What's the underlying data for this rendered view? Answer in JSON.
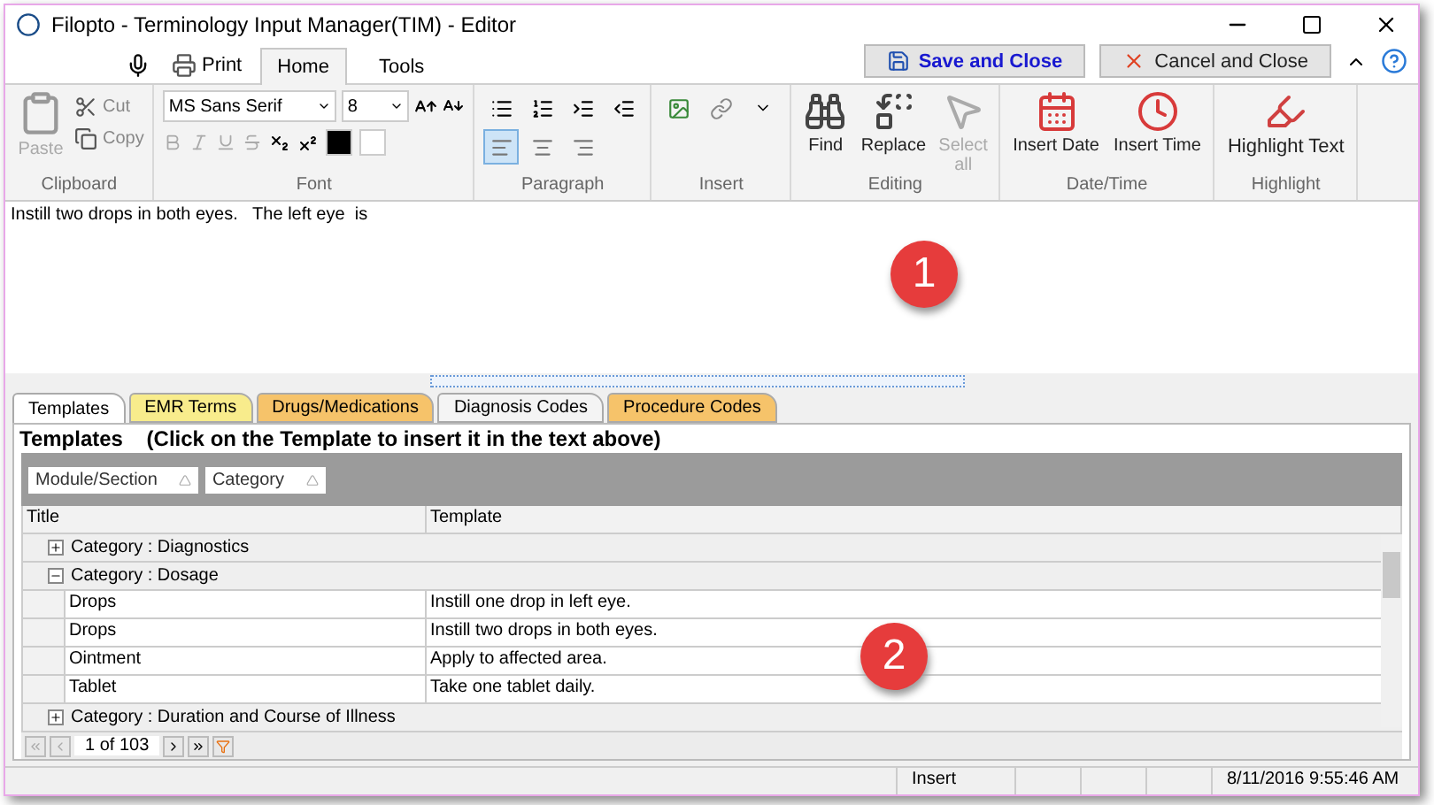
{
  "window": {
    "title": "Filopto - Terminology Input Manager(TIM) - Editor"
  },
  "quick_access": {
    "print": "Print"
  },
  "ribbon_tabs": [
    {
      "label": "Home",
      "selected": true
    },
    {
      "label": "Tools",
      "selected": false
    }
  ],
  "actions": [
    {
      "label": "Save and Close",
      "kind": "save"
    },
    {
      "label": "Cancel and Close",
      "kind": "cancel"
    }
  ],
  "clipboard": {
    "title": "Clipboard",
    "paste": "Paste",
    "cut": "Cut",
    "copy": "Copy"
  },
  "font": {
    "title": "Font",
    "family": "MS Sans Serif",
    "size": "8"
  },
  "paragraph": {
    "title": "Paragraph",
    "align_buttons": [
      {
        "kind": "left",
        "selected": true
      },
      {
        "kind": "center",
        "selected": false
      },
      {
        "kind": "right",
        "selected": false
      }
    ]
  },
  "insert": {
    "title": "Insert"
  },
  "editing": {
    "title": "Editing",
    "buttons": [
      {
        "label": "Find",
        "kind": "find",
        "disabled": false
      },
      {
        "label": "Replace",
        "kind": "replace",
        "disabled": false
      },
      {
        "label": "Select all",
        "kind": "select",
        "disabled": true
      }
    ]
  },
  "datetime": {
    "title": "Date/Time",
    "buttons": [
      {
        "label": "Insert Date",
        "kind": "date"
      },
      {
        "label": "Insert Time",
        "kind": "time"
      }
    ]
  },
  "highlight": {
    "title": "Highlight",
    "button": "Highlight Text"
  },
  "editor": {
    "value": "Instill two drops in both eyes.   The left eye  is",
    "callout": "1"
  },
  "lookup_tabs": [
    {
      "label": "Templates",
      "selected": true,
      "color": "#ffffff"
    },
    {
      "label": "EMR Terms",
      "selected": false,
      "color": "#f8ec8c"
    },
    {
      "label": "Drugs/Medications",
      "selected": false,
      "color": "#f6c36a"
    },
    {
      "label": "Diagnosis Codes",
      "selected": false,
      "color": "#f4f4f4"
    },
    {
      "label": "Procedure Codes",
      "selected": false,
      "color": "#f6c36a"
    }
  ],
  "templates": {
    "title": "Templates",
    "hint": "(Click on the Template to insert it in the text above)",
    "group_by": [
      "Module/Section",
      "Category"
    ],
    "columns": [
      "Title",
      "Template"
    ],
    "groups": [
      {
        "label": "Category : Diagnostics",
        "expanded": false
      },
      {
        "label": "Category : Dosage",
        "expanded": true,
        "rows": [
          [
            "Drops",
            "Instill one drop in left eye."
          ],
          [
            "Drops",
            "Instill two drops in both eyes."
          ],
          [
            "Ointment",
            "Apply to affected area."
          ],
          [
            "Tablet",
            "Take one tablet daily."
          ]
        ]
      },
      {
        "label": "Category : Duration and Course of Illness",
        "expanded": false
      }
    ],
    "callout": "2"
  },
  "pager": {
    "text": "1 of 103"
  },
  "status_bar": {
    "mode": "Insert",
    "datetime": "8/11/2016 9:55:46 AM"
  }
}
